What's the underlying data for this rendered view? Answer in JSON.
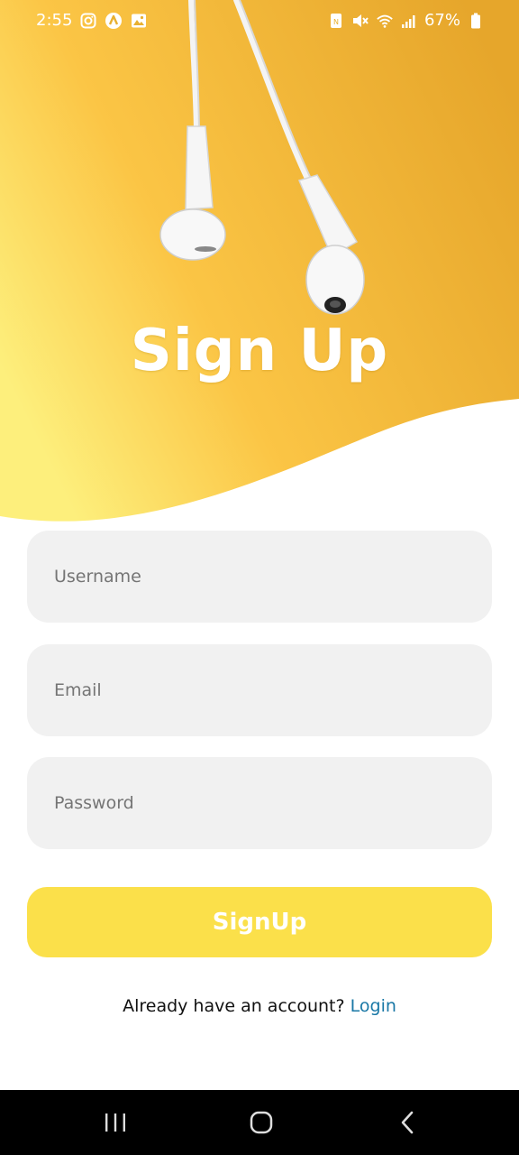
{
  "status_bar": {
    "time": "2:55",
    "left_icons": [
      "instagram-icon",
      "app-notification-icon",
      "gallery-icon"
    ],
    "right_icons": [
      "nfc-icon",
      "mute-icon",
      "wifi-icon",
      "signal-icon",
      "battery-icon"
    ],
    "battery": "67%"
  },
  "header": {
    "title": "Sign Up",
    "gradient_colors": [
      "#fdef7c",
      "#fbc545",
      "#e8a82a"
    ]
  },
  "form": {
    "username": {
      "placeholder": "Username",
      "value": ""
    },
    "email": {
      "placeholder": "Email",
      "value": ""
    },
    "password": {
      "placeholder": "Password",
      "value": ""
    },
    "submit_label": "SignUp"
  },
  "footer": {
    "prompt": "Already have an account?",
    "login_label": "Login"
  },
  "nav_bar": {
    "buttons": [
      "recent-apps-icon",
      "home-icon",
      "back-icon"
    ]
  },
  "colors": {
    "accent": "#fbe04a",
    "link": "#1a78a6",
    "field_bg": "#f1f1f1"
  }
}
